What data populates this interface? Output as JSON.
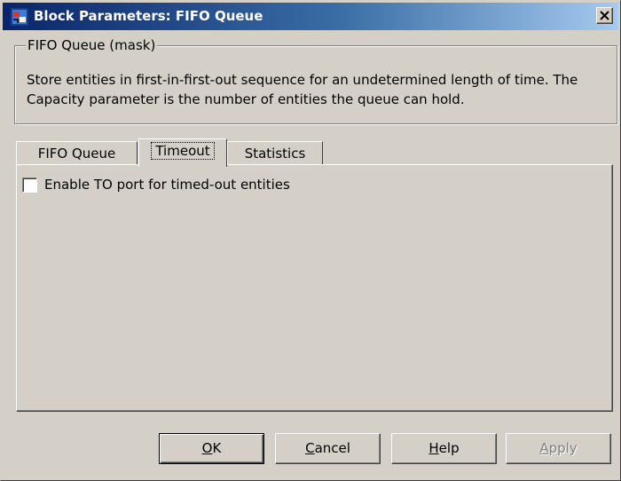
{
  "window": {
    "title": "Block Parameters: FIFO Queue"
  },
  "group": {
    "legend": "FIFO Queue (mask)",
    "description": "Store entities in first-in-first-out sequence for an undetermined length of time. The Capacity parameter is the number of entities the queue can hold."
  },
  "tabs": [
    {
      "label": "FIFO Queue",
      "active": false
    },
    {
      "label": "Timeout",
      "active": true
    },
    {
      "label": "Statistics",
      "active": false
    }
  ],
  "timeout_panel": {
    "checkbox_label": "Enable TO port for timed-out entities",
    "checked": false
  },
  "buttons": {
    "ok": {
      "first": "O",
      "rest": "K"
    },
    "cancel": {
      "first": "C",
      "rest": "ancel"
    },
    "help": {
      "first": "H",
      "rest": "elp"
    },
    "apply": {
      "first": "A",
      "rest": "pply",
      "enabled": false
    }
  },
  "colors": {
    "dialog_bg": "#d4d0c8",
    "titlebar_start": "#0a246a",
    "titlebar_end": "#a6caf0",
    "disabled_text": "#808080"
  }
}
